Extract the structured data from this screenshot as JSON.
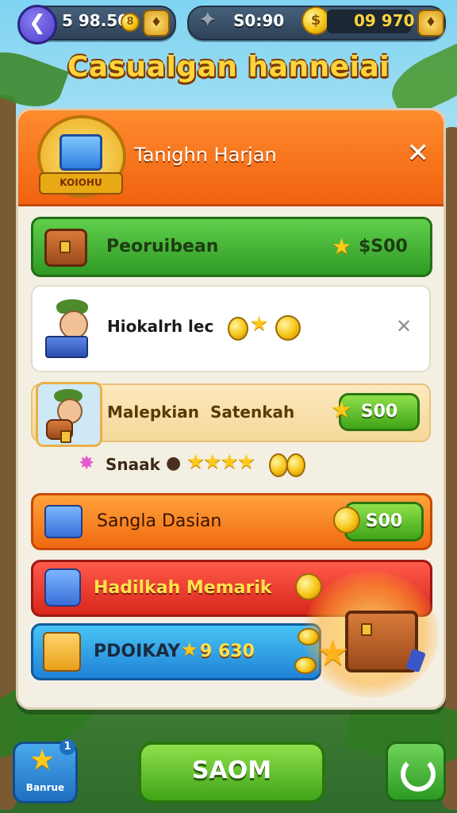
{
  "header": {
    "back_icon": "back-arrow-icon",
    "currency_left": "5 98.50",
    "currency_left_suffix": "8",
    "currency_mid": "S0:90",
    "currency_right": "09 970"
  },
  "game_title": "Casualgan hanneiai",
  "panel": {
    "title": "Tanighn Harjan",
    "badge_label": "KOIOHU",
    "close_icon": "close-icon"
  },
  "rows": [
    {
      "label": "Peoruibean",
      "price": "$S00"
    },
    {
      "label": "Hiokalrh lec"
    },
    {
      "label": "Malepkian  Satenkah",
      "price": "S00"
    },
    {
      "label": "Snaak"
    },
    {
      "label": "Sangla Dasian",
      "price": "S00"
    },
    {
      "label": "Hadilkah Memarik"
    },
    {
      "label": "PDOIKAY",
      "price": "9 630"
    }
  ],
  "bottom": {
    "left_label": "Banrue",
    "left_badge": "1",
    "main_button": "SAOM",
    "right_icon": "refresh-icon"
  },
  "colors": {
    "header_orange": "#f0620f",
    "green": "#3fa418",
    "gold": "#ffc91a",
    "panel_bg": "#f4efe3"
  }
}
